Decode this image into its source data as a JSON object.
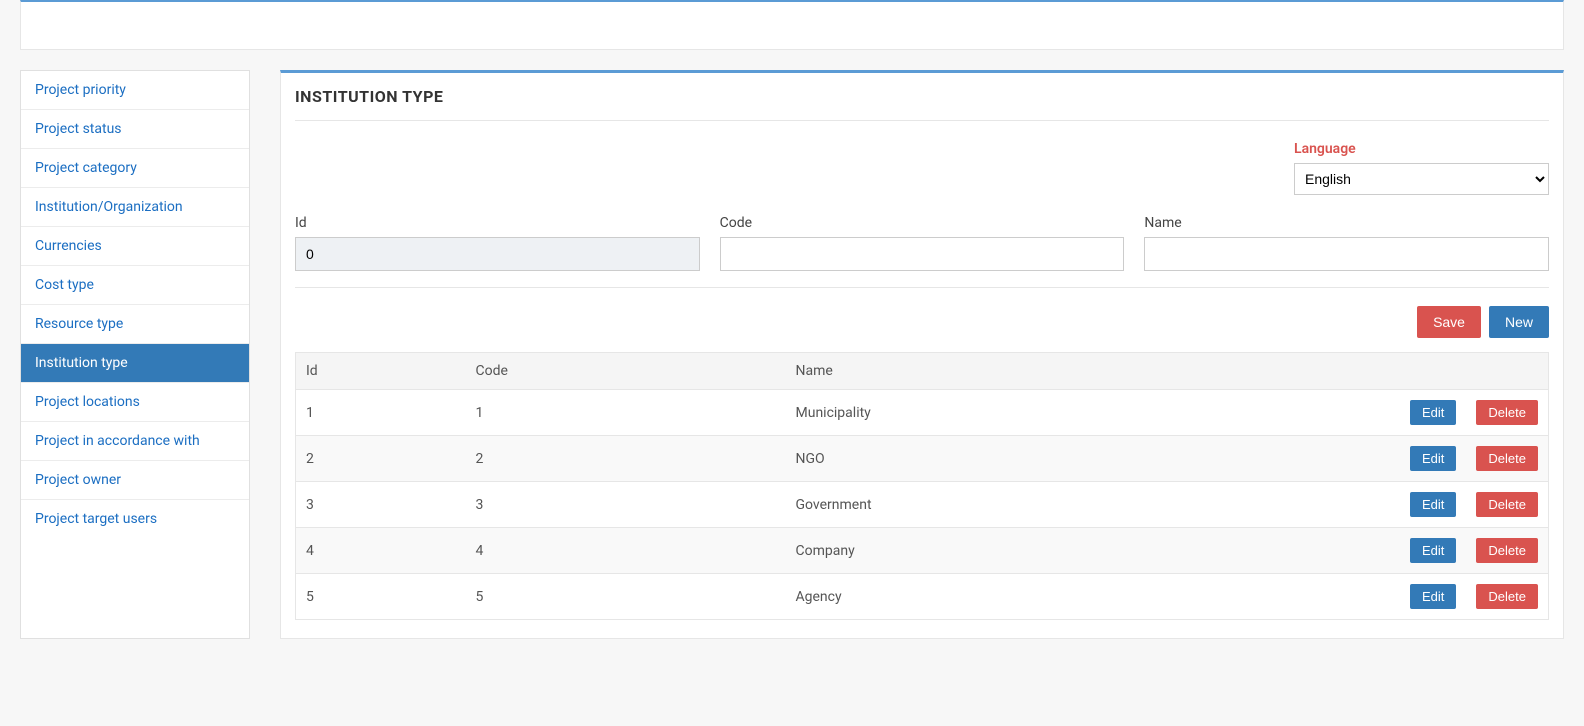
{
  "page_title": "INSTITUTION TYPE",
  "sidebar": {
    "items": [
      {
        "label": "Project priority",
        "active": false
      },
      {
        "label": "Project status",
        "active": false
      },
      {
        "label": "Project category",
        "active": false
      },
      {
        "label": "Institution/Organization",
        "active": false
      },
      {
        "label": "Currencies",
        "active": false
      },
      {
        "label": "Cost type",
        "active": false
      },
      {
        "label": "Resource type",
        "active": false
      },
      {
        "label": "Institution type",
        "active": true
      },
      {
        "label": "Project locations",
        "active": false
      },
      {
        "label": "Project in accordance with",
        "active": false
      },
      {
        "label": "Project owner",
        "active": false
      },
      {
        "label": "Project target users",
        "active": false
      }
    ]
  },
  "form": {
    "language_label": "Language",
    "language_value": "English",
    "id_label": "Id",
    "id_value": "0",
    "code_label": "Code",
    "code_value": "",
    "name_label": "Name",
    "name_value": ""
  },
  "buttons": {
    "save": "Save",
    "new": "New",
    "edit": "Edit",
    "delete": "Delete"
  },
  "table": {
    "headers": {
      "id": "Id",
      "code": "Code",
      "name": "Name"
    },
    "rows": [
      {
        "id": "1",
        "code": "1",
        "name": "Municipality"
      },
      {
        "id": "2",
        "code": "2",
        "name": "NGO"
      },
      {
        "id": "3",
        "code": "3",
        "name": "Government"
      },
      {
        "id": "4",
        "code": "4",
        "name": "Company"
      },
      {
        "id": "5",
        "code": "5",
        "name": "Agency"
      }
    ]
  }
}
